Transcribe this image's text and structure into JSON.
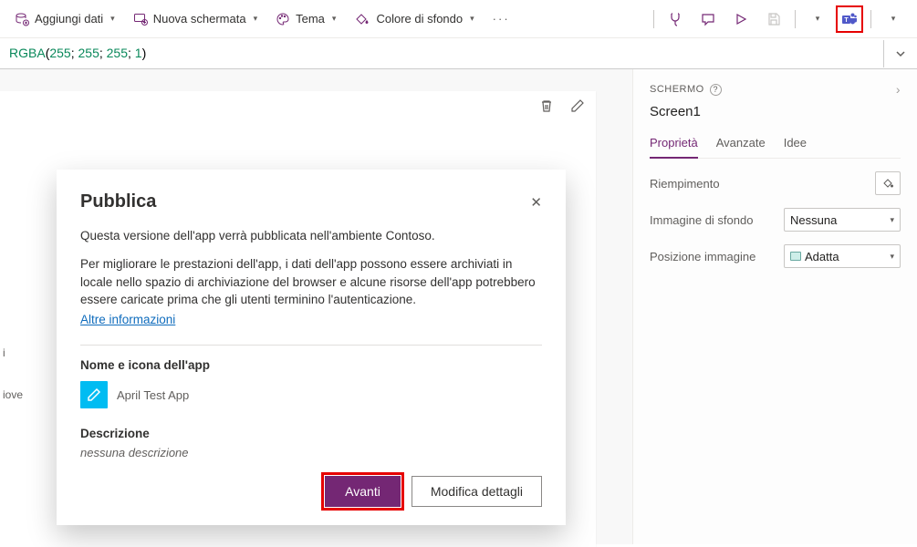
{
  "toolbar": {
    "add_data": "Aggiungi dati",
    "new_screen": "Nuova schermata",
    "theme": "Tema",
    "bg_color": "Colore di sfondo"
  },
  "formula": {
    "fn": "RGBA",
    "a": "255",
    "b": "255",
    "c": "255",
    "d": "1"
  },
  "panel": {
    "header": "SCHERMO",
    "screen": "Screen1",
    "tabs": {
      "props": "Proprietà",
      "adv": "Avanzate",
      "ideas": "Idee"
    },
    "fill": "Riempimento",
    "bgimg": "Immagine di sfondo",
    "bgimg_val": "Nessuna",
    "imgpos": "Posizione immagine",
    "imgpos_val": "Adatta"
  },
  "modal": {
    "title": "Pubblica",
    "line1": "Questa versione dell'app verrà pubblicata nell'ambiente Contoso.",
    "line2": "Per migliorare le prestazioni dell'app, i dati dell'app possono essere archiviati in locale nello spazio di archiviazione del browser e alcune risorse dell'app potrebbero essere caricate prima che gli utenti terminino l'autenticazione.",
    "link": "Altre informazioni",
    "section_name": "Nome e icona dell'app",
    "app_name": "April Test App",
    "section_desc": "Descrizione",
    "desc_value": "nessuna descrizione",
    "btn_next": "Avanti",
    "btn_edit": "Modifica dettagli"
  },
  "left": {
    "a": "i",
    "b": "iove"
  }
}
